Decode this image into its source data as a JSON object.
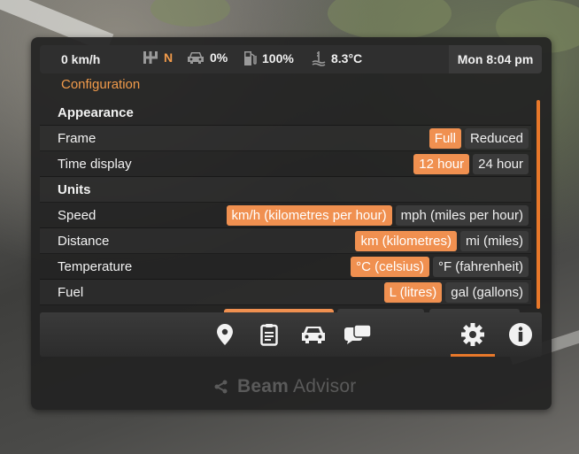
{
  "status": {
    "speed": "0 km/h",
    "gear": "N",
    "damage": "0%",
    "fuel": "100%",
    "temperature": "8.3°C",
    "time": "Mon 8:04 pm"
  },
  "section_title": "Configuration",
  "settings": {
    "appearance_header": "Appearance",
    "frame": {
      "label": "Frame",
      "options": [
        "Full",
        "Reduced"
      ],
      "selected": "Full"
    },
    "time_display": {
      "label": "Time display",
      "options": [
        "12 hour",
        "24 hour"
      ],
      "selected": "12 hour"
    },
    "units_header": "Units",
    "speed": {
      "label": "Speed",
      "options": [
        "km/h (kilometres per hour)",
        "mph (miles per hour)"
      ],
      "selected": "km/h (kilometres per hour)"
    },
    "distance": {
      "label": "Distance",
      "options": [
        "km (kilometres)",
        "mi (miles)"
      ],
      "selected": "km (kilometres)"
    },
    "temperature": {
      "label": "Temperature",
      "options": [
        "°C (celsius)",
        "°F (fahrenheit)"
      ],
      "selected": "°C (celsius)"
    },
    "fuel": {
      "label": "Fuel",
      "options": [
        "L (litres)",
        "gal (gallons)"
      ],
      "selected": "L (litres)"
    }
  },
  "nav": {
    "items": [
      "map-pin-icon",
      "clipboard-icon",
      "car-icon",
      "chat-icon",
      "gear-icon",
      "info-icon"
    ],
    "active": "gear-icon"
  },
  "brand": {
    "word1": "Beam",
    "word2": "Advisor"
  },
  "colors": {
    "accent": "#f09050",
    "panel": "#222222",
    "option": "#3b3b3b"
  }
}
